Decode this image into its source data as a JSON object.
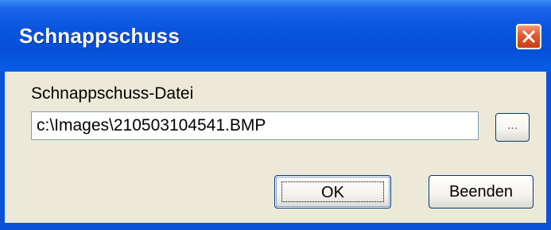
{
  "window": {
    "title": "Schnappschuss",
    "close_icon": "close-icon"
  },
  "form": {
    "label": "Schnappschuss-Datei",
    "path_value": "c:\\Images\\210503104541.BMP",
    "browse_label": "...",
    "ok_label": "OK",
    "exit_label": "Beenden"
  },
  "colors": {
    "titlebar": "#0a55e0",
    "client_bg": "#ece9d8",
    "close_button": "#e2582f",
    "input_border": "#7f9db9"
  }
}
